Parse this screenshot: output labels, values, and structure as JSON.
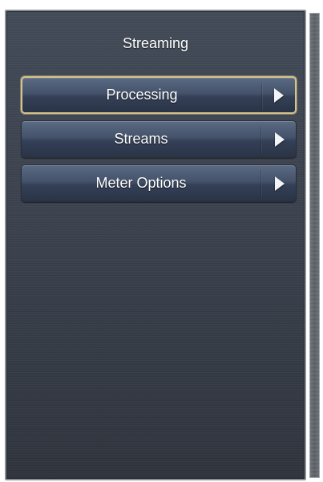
{
  "panel": {
    "title": "Streaming"
  },
  "menu": {
    "items": [
      {
        "label": "Processing",
        "selected": true,
        "icon": "chevron-right-icon"
      },
      {
        "label": "Streams",
        "selected": false,
        "icon": "chevron-right-icon"
      },
      {
        "label": "Meter Options",
        "selected": false,
        "icon": "chevron-right-icon"
      }
    ]
  },
  "colors": {
    "panel_background": "#3b424e",
    "button_background": "#44526a",
    "selected_outline": "#d6c38a",
    "text": "#ffffff"
  }
}
